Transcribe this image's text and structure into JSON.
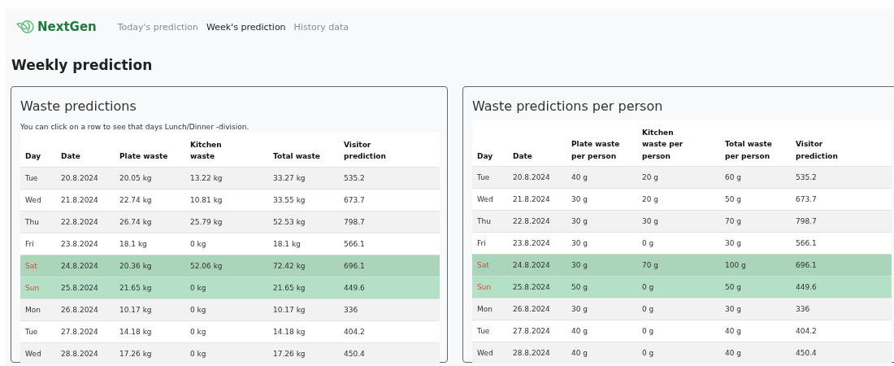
{
  "brand": "NextGen",
  "nav": [
    {
      "label": "Today's prediction",
      "selected": false
    },
    {
      "label": "Week's prediction",
      "selected": true
    },
    {
      "label": "History data",
      "selected": false
    }
  ],
  "page_title": "Weekly prediction",
  "cards": [
    {
      "title": "Waste predictions",
      "note": "You can click on a row to see that days Lunch/Dinner -division.",
      "columns": [
        "Day",
        "Date",
        "Plate waste",
        "Kitchen waste",
        "Total waste",
        "Visitor prediction"
      ],
      "rows": [
        {
          "weekend": false,
          "cells": [
            "Tue",
            "20.8.2024",
            "20.05 kg",
            "13.22 kg",
            "33.27 kg",
            "535.2"
          ]
        },
        {
          "weekend": false,
          "cells": [
            "Wed",
            "21.8.2024",
            "22.74 kg",
            "10.81 kg",
            "33.55 kg",
            "673.7"
          ]
        },
        {
          "weekend": false,
          "cells": [
            "Thu",
            "22.8.2024",
            "26.74 kg",
            "25.79 kg",
            "52.53 kg",
            "798.7"
          ]
        },
        {
          "weekend": false,
          "cells": [
            "Fri",
            "23.8.2024",
            "18.1 kg",
            "0 kg",
            "18.1 kg",
            "566.1"
          ]
        },
        {
          "weekend": true,
          "cells": [
            "Sat",
            "24.8.2024",
            "20.36 kg",
            "52.06 kg",
            "72.42 kg",
            "696.1"
          ]
        },
        {
          "weekend": true,
          "cells": [
            "Sun",
            "25.8.2024",
            "21.65 kg",
            "0 kg",
            "21.65 kg",
            "449.6"
          ]
        },
        {
          "weekend": false,
          "cells": [
            "Mon",
            "26.8.2024",
            "10.17 kg",
            "0 kg",
            "10.17 kg",
            "336"
          ]
        },
        {
          "weekend": false,
          "cells": [
            "Tue",
            "27.8.2024",
            "14.18 kg",
            "0 kg",
            "14.18 kg",
            "404.2"
          ]
        },
        {
          "weekend": false,
          "cells": [
            "Wed",
            "28.8.2024",
            "17.26 kg",
            "0 kg",
            "17.26 kg",
            "450.4"
          ]
        }
      ]
    },
    {
      "title": "Waste predictions per person",
      "columns": [
        "Day",
        "Date",
        "Plate waste per person",
        "Kitchen waste per person",
        "Total waste per person",
        "Visitor prediction"
      ],
      "rows": [
        {
          "weekend": false,
          "cells": [
            "Tue",
            "20.8.2024",
            "40 g",
            "20 g",
            "60 g",
            "535.2"
          ]
        },
        {
          "weekend": false,
          "cells": [
            "Wed",
            "21.8.2024",
            "30 g",
            "20 g",
            "50 g",
            "673.7"
          ]
        },
        {
          "weekend": false,
          "cells": [
            "Thu",
            "22.8.2024",
            "30 g",
            "30 g",
            "70 g",
            "798.7"
          ]
        },
        {
          "weekend": false,
          "cells": [
            "Fri",
            "23.8.2024",
            "30 g",
            "0 g",
            "30 g",
            "566.1"
          ]
        },
        {
          "weekend": true,
          "cells": [
            "Sat",
            "24.8.2024",
            "30 g",
            "70 g",
            "100 g",
            "696.1"
          ]
        },
        {
          "weekend": true,
          "cells": [
            "Sun",
            "25.8.2024",
            "50 g",
            "0 g",
            "50 g",
            "449.6"
          ]
        },
        {
          "weekend": false,
          "cells": [
            "Mon",
            "26.8.2024",
            "30 g",
            "0 g",
            "30 g",
            "336"
          ]
        },
        {
          "weekend": false,
          "cells": [
            "Tue",
            "27.8.2024",
            "40 g",
            "0 g",
            "40 g",
            "404.2"
          ]
        },
        {
          "weekend": false,
          "cells": [
            "Wed",
            "28.8.2024",
            "40 g",
            "0 g",
            "40 g",
            "450.4"
          ]
        }
      ]
    }
  ]
}
